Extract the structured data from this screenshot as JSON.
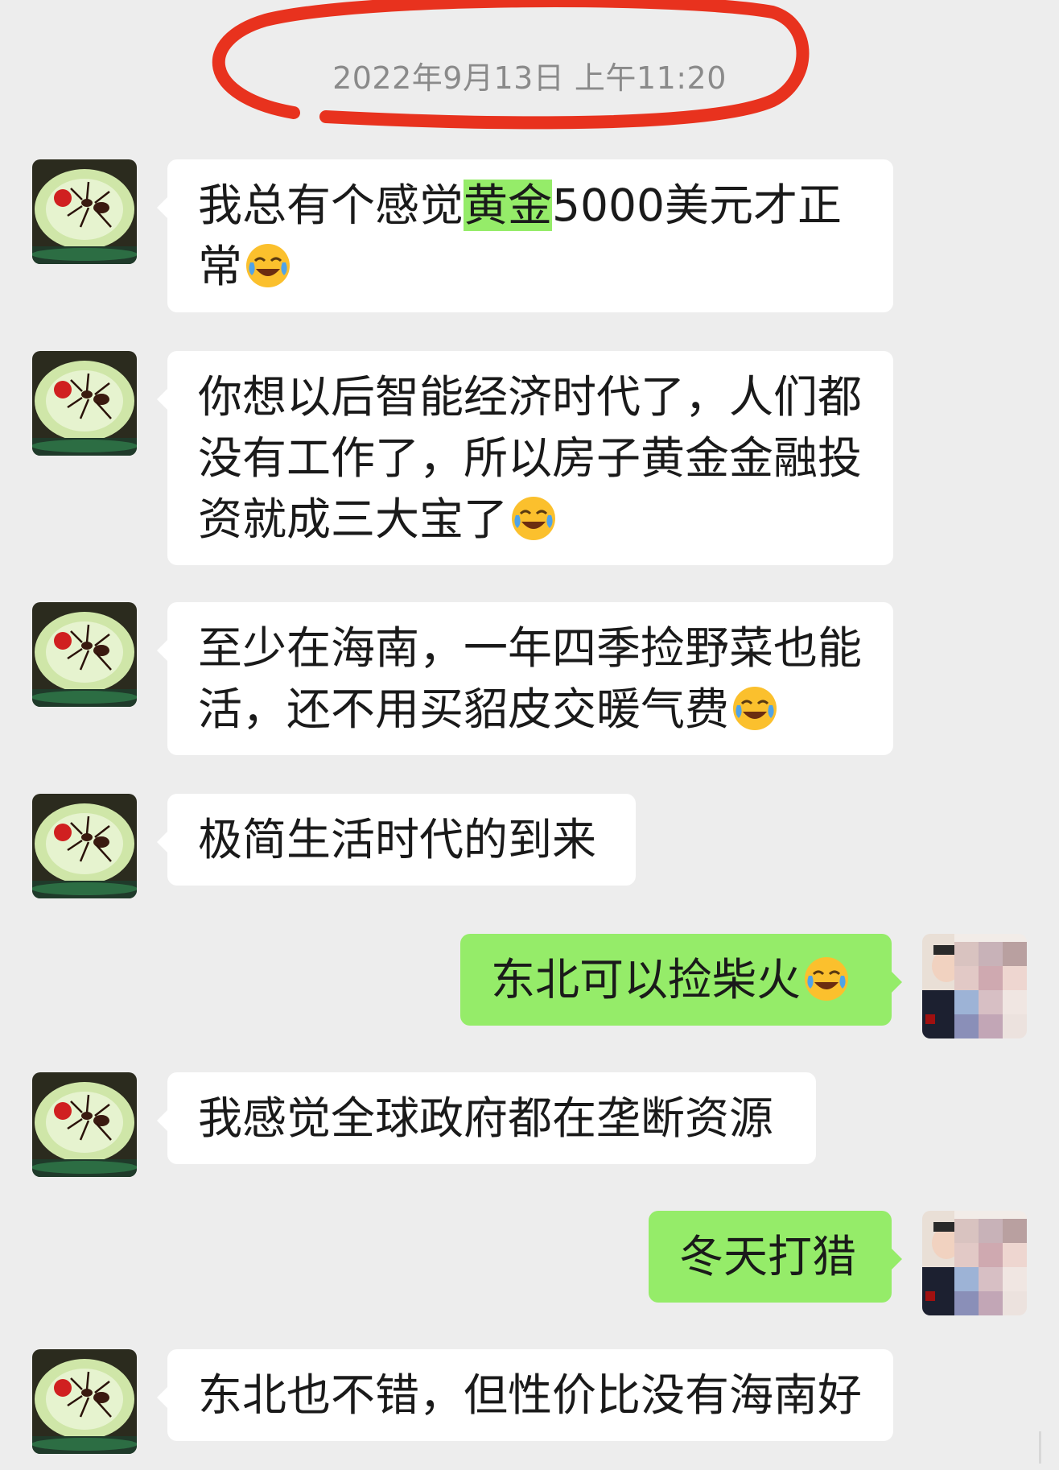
{
  "chat": {
    "timestamp": "2022年9月13日 上午11:20",
    "messages": [
      {
        "side": "in",
        "before": "我总有个感觉",
        "highlight": "黄金",
        "after": "5000美元才正\n常",
        "emoji": "tears-of-joy-emoji"
      },
      {
        "side": "in",
        "text": "你想以后智能经济时代了，人们都\n没有工作了，所以房子黄金金融投\n资就成三大宝了",
        "emoji": "tears-of-joy-emoji"
      },
      {
        "side": "in",
        "text": "至少在海南，一年四季捡野菜也能\n活，还不用买貂皮交暖气费",
        "emoji": "tears-of-joy-emoji"
      },
      {
        "side": "in",
        "text": "极简生活时代的到来"
      },
      {
        "side": "out",
        "text": "东北可以捡柴火",
        "emoji": "tears-of-joy-emoji"
      },
      {
        "side": "in",
        "text": "我感觉全球政府都在垄断资源"
      },
      {
        "side": "out",
        "text": "冬天打猎"
      },
      {
        "side": "in",
        "text": "东北也不错，但性价比没有海南好"
      }
    ]
  },
  "colors": {
    "background": "#ededed",
    "incoming_bubble": "#ffffff",
    "outgoing_bubble": "#95ec69",
    "annotation_circle": "#e8321e"
  },
  "icons": {
    "incoming_avatar": "ant-avatar",
    "outgoing_avatar": "pixelated-avatar",
    "emoji": "tears-of-joy-emoji"
  }
}
